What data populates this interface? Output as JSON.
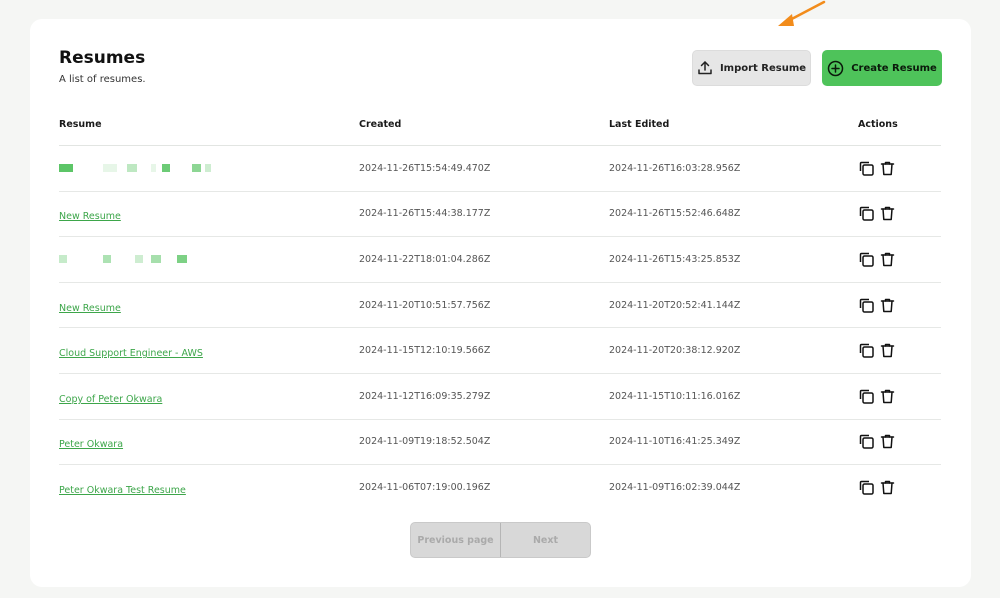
{
  "header": {
    "title": "Resumes",
    "subtitle": "A list of resumes.",
    "import_label": "Import Resume",
    "create_label": "Create Resume"
  },
  "columns": [
    "Resume",
    "Created",
    "Last Edited",
    "Actions"
  ],
  "rows": [
    {
      "name": "",
      "blurred": true,
      "created": "2024-11-26T15:54:49.470Z",
      "edited": "2024-11-26T16:03:28.956Z"
    },
    {
      "name": "New Resume",
      "blurred": false,
      "created": "2024-11-26T15:44:38.177Z",
      "edited": "2024-11-26T15:52:46.648Z"
    },
    {
      "name": "",
      "blurred": true,
      "created": "2024-11-22T18:01:04.286Z",
      "edited": "2024-11-26T15:43:25.853Z"
    },
    {
      "name": "New Resume",
      "blurred": false,
      "created": "2024-11-20T10:51:57.756Z",
      "edited": "2024-11-20T20:52:41.144Z"
    },
    {
      "name": "Cloud Support Engineer - AWS",
      "blurred": false,
      "created": "2024-11-15T12:10:19.566Z",
      "edited": "2024-11-20T20:38:12.920Z"
    },
    {
      "name": "Copy of Peter Okwara",
      "blurred": false,
      "created": "2024-11-12T16:09:35.279Z",
      "edited": "2024-11-15T10:11:16.016Z"
    },
    {
      "name": "Peter Okwara",
      "blurred": false,
      "created": "2024-11-09T19:18:52.504Z",
      "edited": "2024-11-10T16:41:25.349Z"
    },
    {
      "name": "Peter Okwara Test Resume",
      "blurred": false,
      "created": "2024-11-06T07:19:00.196Z",
      "edited": "2024-11-09T16:02:39.044Z"
    }
  ],
  "pagination": {
    "prev_label": "Previous page",
    "next_label": "Next"
  },
  "colors": {
    "accent": "#4ec35a",
    "link": "#3da64a",
    "arrow": "#f28c1b"
  },
  "icons": {
    "import": "upload-icon",
    "create": "plus-circle-icon",
    "copy": "copy-icon",
    "delete": "trash-icon"
  }
}
